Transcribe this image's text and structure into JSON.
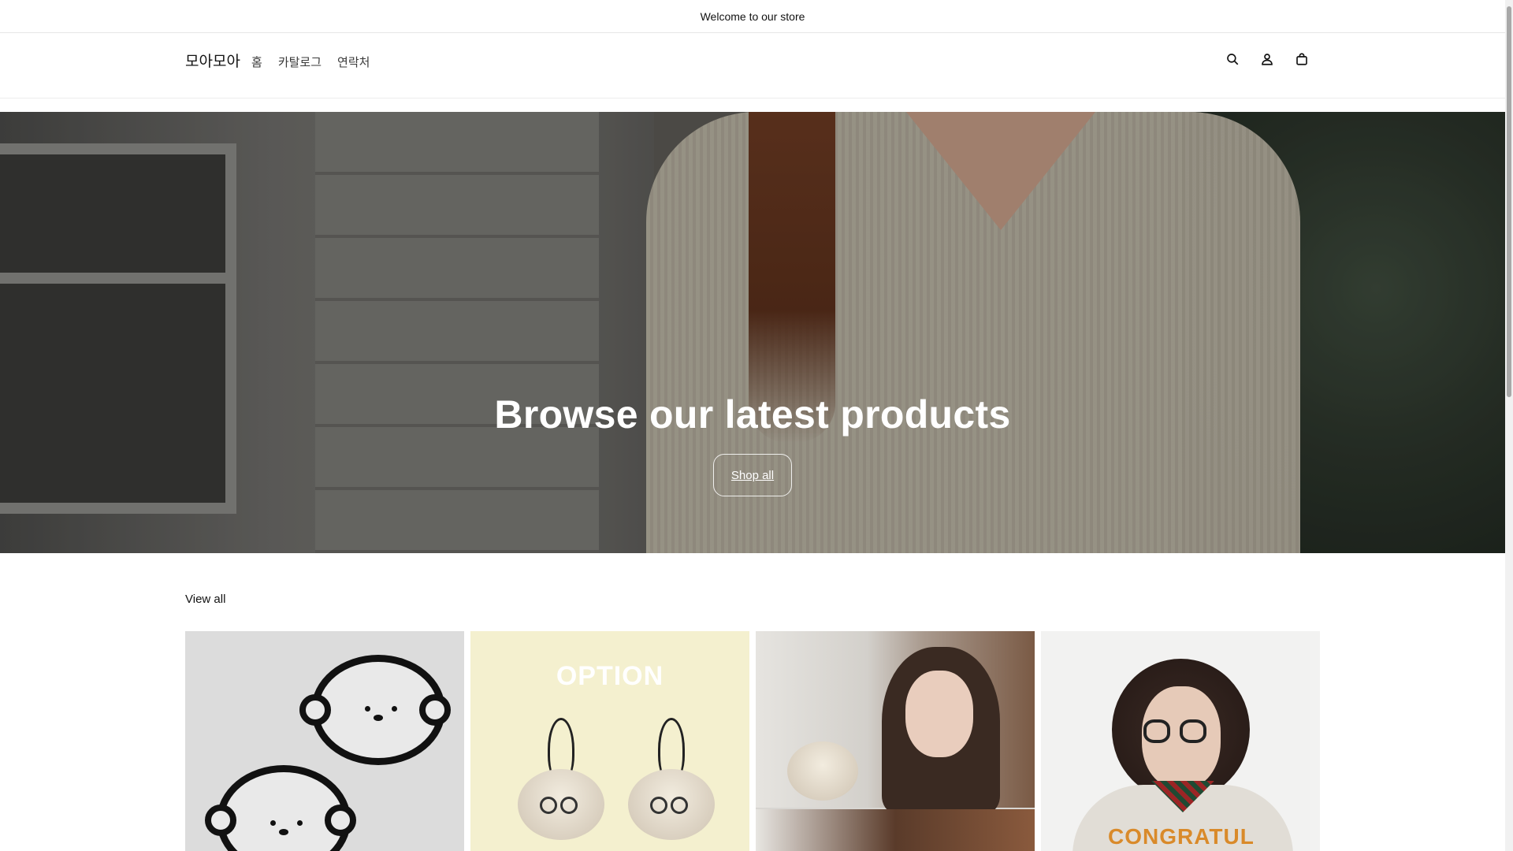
{
  "announcement": {
    "text": "Welcome to our store"
  },
  "header": {
    "logo": "모아모아",
    "nav": [
      {
        "label": "홈"
      },
      {
        "label": "카탈로그"
      },
      {
        "label": "연락처"
      }
    ],
    "icons": [
      "search-icon",
      "account-icon",
      "cart-icon"
    ]
  },
  "hero": {
    "title": "Browse our latest products",
    "button_label": "Shop all"
  },
  "collection": {
    "view_all_label": "View all",
    "products": [
      {
        "image": "bear-face-patches"
      },
      {
        "image": "plush-keyrings",
        "overlay_text": "OPTION"
      },
      {
        "image": "model-with-keyring"
      },
      {
        "image": "model-with-sweatshirt",
        "overlay_text": "CONGRATUL"
      }
    ]
  },
  "colors": {
    "text": "#121212",
    "border": "#e6e6e6",
    "hero_button_border": "#ffffff"
  }
}
